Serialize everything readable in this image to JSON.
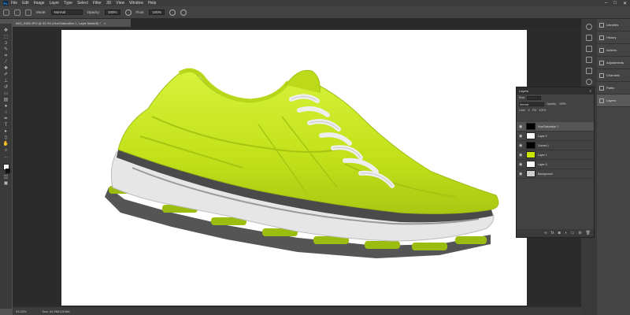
{
  "menubar": {
    "logo": "Ps",
    "items": [
      "File",
      "Edit",
      "Image",
      "Layer",
      "Type",
      "Select",
      "Filter",
      "3D",
      "View",
      "Window",
      "Help"
    ],
    "win_controls": [
      "–",
      "□",
      "✕"
    ]
  },
  "options": {
    "mode_label": "Mode:",
    "mode_value": "Normal",
    "opacity_label": "Opacity:",
    "opacity_value": "100%",
    "flow_label": "Flow:",
    "flow_value": "100%"
  },
  "document_tab": {
    "title": "IMG_9185.JPG @ 33.3% (Hue/Saturation 1, Layer Mask/8) *",
    "close": "×"
  },
  "status": {
    "zoom": "33.33%",
    "doc": "Doc: 34.9M/129.6M"
  },
  "panels": {
    "items": [
      {
        "label": "Libraries",
        "icon": "libraries-icon"
      },
      {
        "label": "History",
        "icon": "history-icon"
      },
      {
        "label": "Actions",
        "icon": "actions-icon"
      },
      {
        "label": "Adjustments",
        "icon": "adjustments-icon"
      },
      {
        "label": "Channels",
        "icon": "channels-icon"
      },
      {
        "label": "Paths",
        "icon": "paths-icon"
      },
      {
        "label": "Layers",
        "icon": "layers-icon"
      }
    ]
  },
  "layers_panel": {
    "title": "Layers",
    "kind_label": "Kind",
    "blend_mode": "Normal",
    "opacity_label": "Opacity:",
    "opacity_value": "100%",
    "lock_label": "Lock:",
    "fill_label": "Fill:",
    "fill_value": "100%",
    "layers": [
      {
        "name": "Hue/Saturation 1",
        "thumb": "mask",
        "selected": true
      },
      {
        "name": "Layer 2",
        "thumb": "white",
        "selected": false
      },
      {
        "name": "Curves 1",
        "thumb": "mask",
        "selected": false
      },
      {
        "name": "Layer 1",
        "thumb": "shoe",
        "selected": false
      },
      {
        "name": "Layer 0",
        "thumb": "white",
        "selected": false
      },
      {
        "name": "Background",
        "thumb": "gray",
        "selected": false
      }
    ]
  },
  "colors": {
    "shoe_upper": "#c6e61b",
    "shoe_sole": "#e3e3e3",
    "shoe_dark": "#4a4a4a",
    "lace": "#eeeeee"
  }
}
